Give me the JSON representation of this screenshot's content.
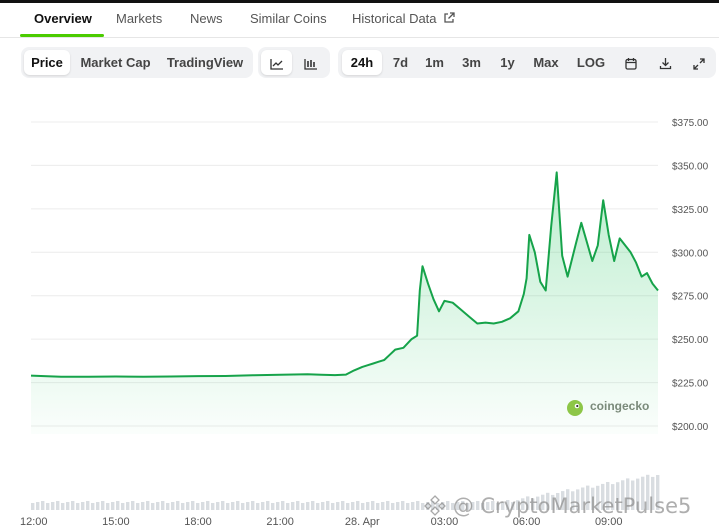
{
  "tabs": [
    {
      "label": "Overview",
      "active": true
    },
    {
      "label": "Markets"
    },
    {
      "label": "News"
    },
    {
      "label": "Similar Coins"
    },
    {
      "label": "Historical Data",
      "icon": "external-link-icon"
    }
  ],
  "toolbar": {
    "metric_buttons": [
      {
        "label": "Price",
        "active": true
      },
      {
        "label": "Market Cap"
      },
      {
        "label": "TradingView"
      }
    ],
    "chart_type_buttons": [
      {
        "icon": "line-chart-icon"
      },
      {
        "icon": "candlestick-icon"
      }
    ],
    "range_buttons": [
      {
        "label": "24h",
        "active": true
      },
      {
        "label": "7d"
      },
      {
        "label": "1m"
      },
      {
        "label": "3m"
      },
      {
        "label": "1y"
      },
      {
        "label": "Max"
      },
      {
        "label": "LOG"
      }
    ],
    "icon_buttons": [
      {
        "icon": "calendar-icon"
      },
      {
        "icon": "download-icon"
      },
      {
        "icon": "expand-icon"
      }
    ]
  },
  "chart_data": {
    "type": "area",
    "y_ticks": [
      "$375.00",
      "$350.00",
      "$325.00",
      "$300.00",
      "$275.00",
      "$250.00",
      "$225.00",
      "$200.00"
    ],
    "ylim": [
      200,
      375
    ],
    "x_ticks": [
      "12:00",
      "15:00",
      "18:00",
      "21:00",
      "28. Apr",
      "03:00",
      "06:00",
      "09:00"
    ],
    "x_tick_hours": [
      12,
      15,
      18,
      21,
      24,
      27,
      30,
      33
    ],
    "xlim": [
      11.9,
      34.8
    ],
    "line_color": "#16a34a",
    "price_points": [
      [
        11.9,
        229
      ],
      [
        12.5,
        228.6
      ],
      [
        13.0,
        228.3
      ],
      [
        14.0,
        228.3
      ],
      [
        15.0,
        228.5
      ],
      [
        16.0,
        228.3
      ],
      [
        17.0,
        228.5
      ],
      [
        18.0,
        228.7
      ],
      [
        19.0,
        228.8
      ],
      [
        20.0,
        229.2
      ],
      [
        21.0,
        229.5
      ],
      [
        22.0,
        229.8
      ],
      [
        22.5,
        229.5
      ],
      [
        23.0,
        229.3
      ],
      [
        23.4,
        229.6
      ],
      [
        23.7,
        232
      ],
      [
        24.0,
        234
      ],
      [
        24.2,
        235
      ],
      [
        24.4,
        236
      ],
      [
        24.6,
        237
      ],
      [
        24.8,
        238
      ],
      [
        25.0,
        241
      ],
      [
        25.2,
        244
      ],
      [
        25.5,
        245
      ],
      [
        25.8,
        250
      ],
      [
        26.0,
        252
      ],
      [
        26.1,
        278
      ],
      [
        26.2,
        292
      ],
      [
        26.4,
        282
      ],
      [
        26.6,
        273
      ],
      [
        26.8,
        266
      ],
      [
        27.0,
        272
      ],
      [
        27.3,
        271
      ],
      [
        27.6,
        267
      ],
      [
        27.9,
        263
      ],
      [
        28.2,
        259
      ],
      [
        28.5,
        259.5
      ],
      [
        28.8,
        259
      ],
      [
        29.1,
        260
      ],
      [
        29.4,
        262
      ],
      [
        29.7,
        266
      ],
      [
        29.9,
        276
      ],
      [
        30.0,
        285
      ],
      [
        30.1,
        310
      ],
      [
        30.3,
        300
      ],
      [
        30.5,
        283
      ],
      [
        30.7,
        278
      ],
      [
        30.9,
        315
      ],
      [
        31.1,
        346
      ],
      [
        31.3,
        298
      ],
      [
        31.5,
        286
      ],
      [
        31.8,
        305
      ],
      [
        32.0,
        317
      ],
      [
        32.2,
        306
      ],
      [
        32.4,
        295
      ],
      [
        32.6,
        304
      ],
      [
        32.8,
        330
      ],
      [
        33.0,
        310
      ],
      [
        33.2,
        295
      ],
      [
        33.4,
        308
      ],
      [
        33.6,
        304
      ],
      [
        33.8,
        300
      ],
      [
        34.0,
        294
      ],
      [
        34.2,
        286
      ],
      [
        34.4,
        288
      ],
      [
        34.6,
        282
      ],
      [
        34.8,
        278
      ]
    ],
    "grid": true
  },
  "brand": {
    "label": "coingecko"
  },
  "watermark": {
    "text": "@ CryptoMarketPulse5"
  }
}
